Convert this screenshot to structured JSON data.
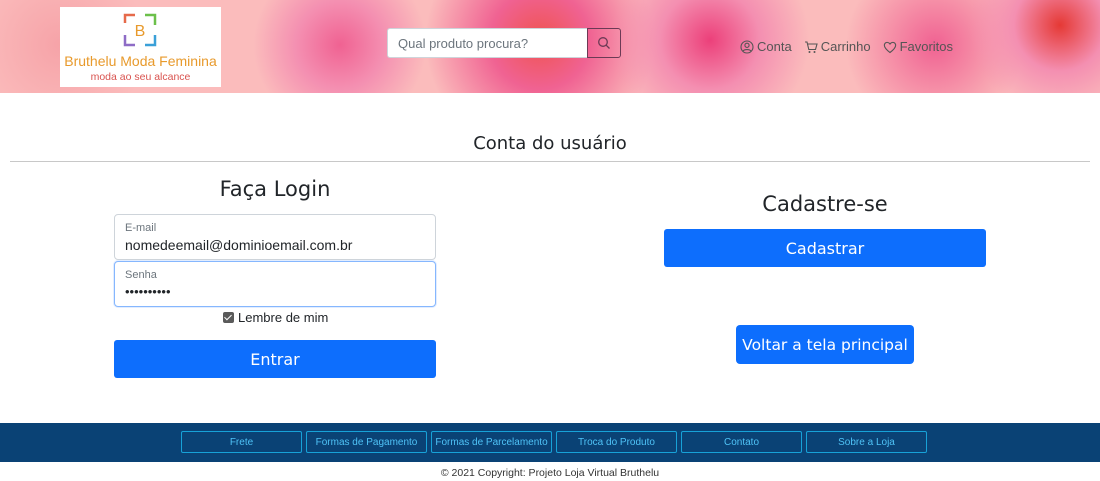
{
  "header": {
    "logo": {
      "letter": "B",
      "title": "Bruthelu Moda Feminina",
      "subtitle": "moda ao seu alcance"
    },
    "search": {
      "placeholder": "Qual produto procura?",
      "icon": "search-icon"
    },
    "nav": [
      {
        "label": "Conta",
        "icon": "user-circle-icon"
      },
      {
        "label": "Carrinho",
        "icon": "cart-icon"
      },
      {
        "label": "Favoritos",
        "icon": "heart-icon"
      }
    ]
  },
  "main": {
    "title": "Conta do usuário",
    "login": {
      "title": "Faça Login",
      "email": {
        "label": "E-mail",
        "value": "nomedeemail@dominioemail.com.br"
      },
      "password": {
        "label": "Senha",
        "value": "••••••••••"
      },
      "remember": {
        "label": "Lembre de mim",
        "checked": true
      },
      "submit": "Entrar"
    },
    "signup": {
      "title": "Cadastre-se",
      "button": "Cadastrar"
    },
    "back_button": "Voltar a tela principal"
  },
  "footer": {
    "links": [
      "Frete",
      "Formas de Pagamento",
      "Formas de Parcelamento",
      "Troca do Produto",
      "Contato",
      "Sobre a Loja"
    ],
    "copyright": "© 2021 Copyright: Projeto Loja Virtual Bruthelu"
  },
  "colors": {
    "primary": "#0d6efd",
    "footer_bg": "#0a4275",
    "footer_link": "#4fc3f7",
    "header_bg": "#fbbcbc"
  }
}
